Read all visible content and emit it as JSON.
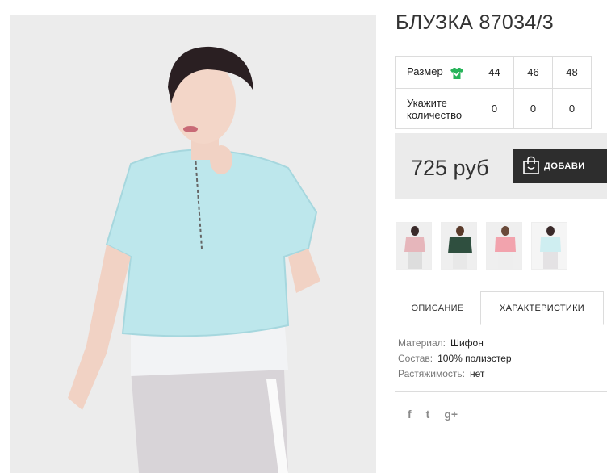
{
  "product": {
    "title": "БЛУЗКА 87034/3"
  },
  "sizes": {
    "size_label": "Размер",
    "qty_label_line1": "Укажите",
    "qty_label_line2": "количество",
    "columns": [
      "44",
      "46",
      "48"
    ],
    "quantities": [
      "0",
      "0",
      "0"
    ]
  },
  "price": {
    "value": "725 руб",
    "cart_button": "ДОБАВИ"
  },
  "tabs": {
    "description": "ОПИСАНИЕ",
    "characteristics": "ХАРАКТЕРИСТИКИ"
  },
  "characteristics": [
    {
      "key": "Материал:",
      "value": "Шифон"
    },
    {
      "key": "Состав:",
      "value": "100% полиэстер"
    },
    {
      "key": "Растяжимость:",
      "value": "нет"
    }
  ],
  "social": {
    "facebook": "f",
    "twitter": "t",
    "googleplus": "g+"
  },
  "icons": {
    "size_chart": "shirt-check-icon",
    "cart": "shopping-bag-icon"
  },
  "colors": {
    "accent_green": "#27b45a",
    "button_dark": "#2d2d2d",
    "price_bg": "#ebebeb",
    "blouse": "#bfe9ee"
  }
}
